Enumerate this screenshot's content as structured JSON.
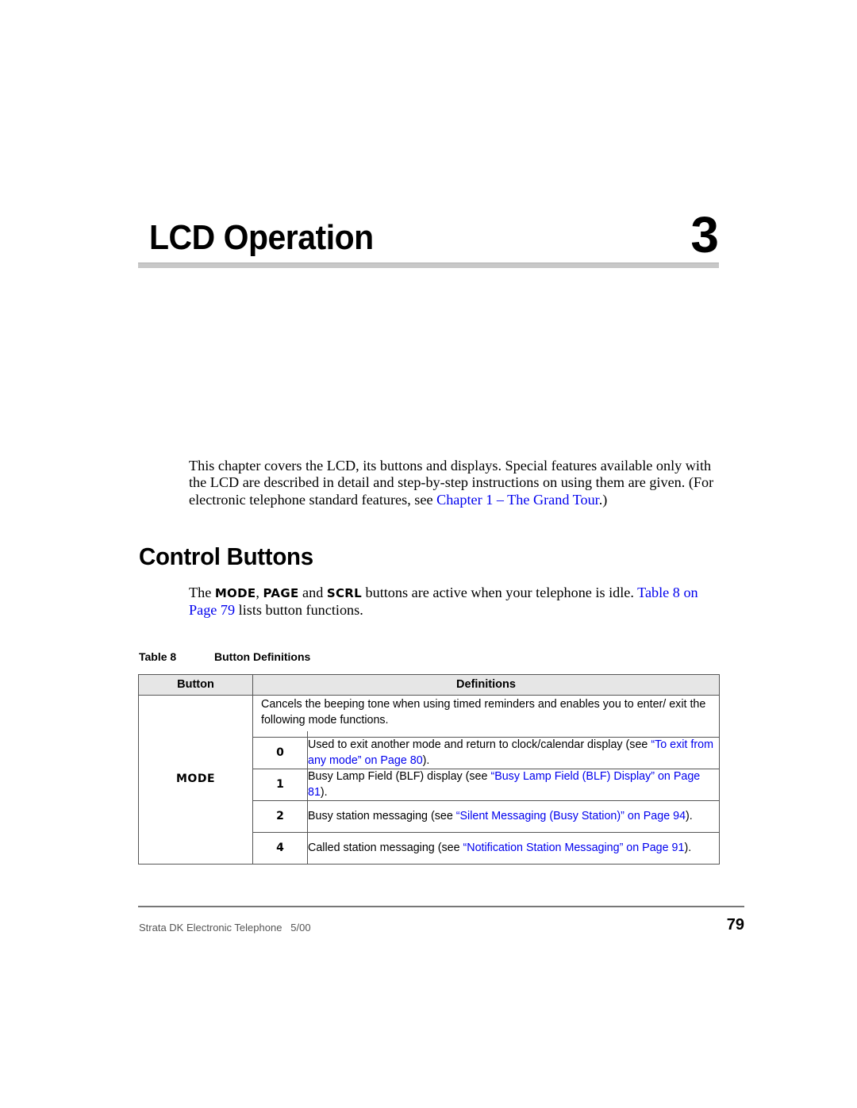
{
  "chapter": {
    "title": "LCD Operation",
    "number": "3"
  },
  "intro": {
    "text": "This chapter covers the LCD, its buttons and displays. Special features available only with the LCD are described in detail and step-by-step instructions on using them are given. (For electronic telephone standard features, see ",
    "link": "Chapter 1 – The Grand Tour",
    "after": ".)"
  },
  "section": {
    "heading": "Control Buttons",
    "para_start": "The ",
    "btn1": "MODE",
    "sep1": ", ",
    "btn2": "PAGE",
    "sep2": " and ",
    "btn3": "SCRL",
    "para_mid": " buttons are active when your telephone is idle. ",
    "link": "Table 8 on Page 79",
    "para_end": " lists button functions."
  },
  "table": {
    "caption_number": "Table 8",
    "caption_title": "Button Definitions",
    "headers": [
      "Button",
      "Definitions"
    ],
    "button": "MODE",
    "intro": "Cancels the beeping tone when using timed reminders and enables you to enter/ exit the following mode functions.",
    "rows": [
      {
        "key": "0",
        "text": "Used to exit another mode and return to clock/calendar display (see ",
        "link": "“To exit from any mode” on Page 80",
        "after": ")."
      },
      {
        "key": "1",
        "text": "Busy Lamp Field (BLF) display (see ",
        "link": "“Busy Lamp Field (BLF) Display” on Page 81",
        "after": ")."
      },
      {
        "key": "2",
        "text": "Busy station messaging (see ",
        "link": "“Silent Messaging (Busy Station)” on Page 94",
        "after": ")."
      },
      {
        "key": "4",
        "text": "Called station messaging (see ",
        "link": "“Notification Station Messaging” on Page 91",
        "after": ")."
      }
    ]
  },
  "footer": {
    "left": "Strata DK Electronic Telephone   5/00",
    "page_number": "79"
  }
}
